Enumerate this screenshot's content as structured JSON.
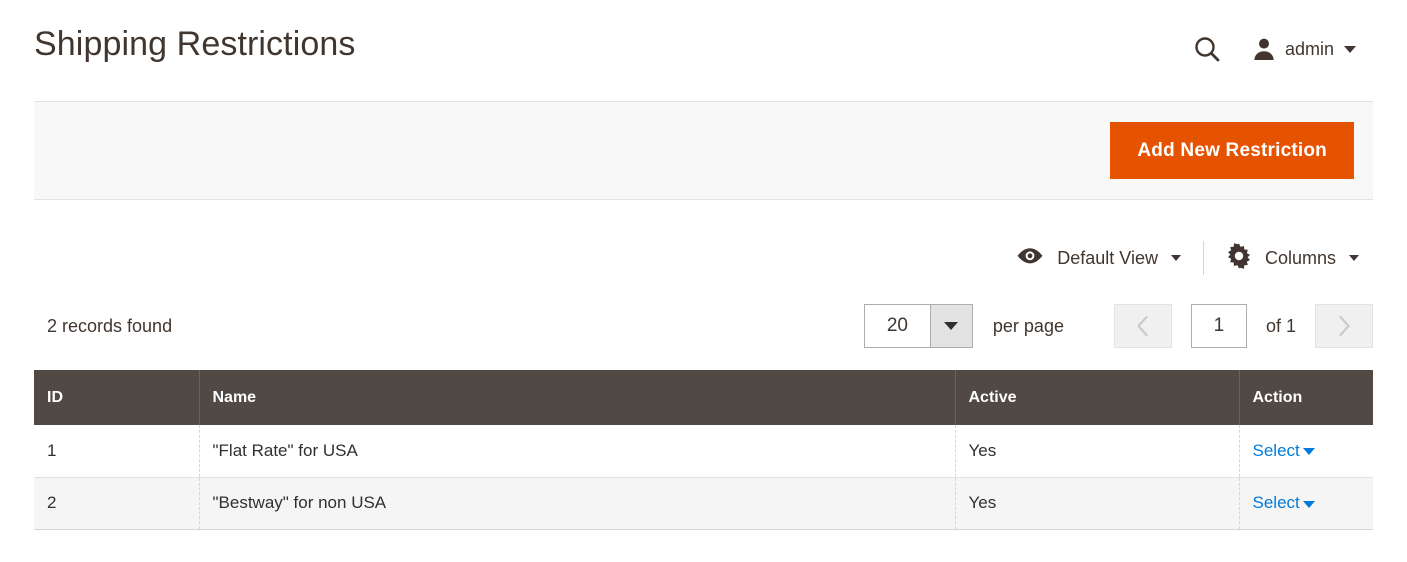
{
  "header": {
    "title": "Shipping Restrictions",
    "search_icon": "search-icon",
    "user_icon": "user-icon",
    "admin_label": "admin"
  },
  "page_actions": {
    "add_button_label": "Add New Restriction",
    "add_button_color": "#e55200"
  },
  "grid_controls": {
    "view_icon": "eye-icon",
    "view_label": "Default View",
    "columns_icon": "gear-icon",
    "columns_label": "Columns"
  },
  "grid_toolbar": {
    "records_found": "2 records found",
    "per_page_value": "20",
    "per_page_label": "per page",
    "prev_icon": "chevron-left-icon",
    "next_icon": "chevron-right-icon",
    "current_page": "1",
    "of_total": "of 1"
  },
  "grid": {
    "columns": [
      {
        "key": "id",
        "label": "ID"
      },
      {
        "key": "name",
        "label": "Name"
      },
      {
        "key": "active",
        "label": "Active"
      },
      {
        "key": "action",
        "label": "Action"
      }
    ],
    "rows": [
      {
        "id": "1",
        "name": "\"Flat Rate\" for USA",
        "active": "Yes",
        "action_label": "Select"
      },
      {
        "id": "2",
        "name": "\"Bestway\" for non USA",
        "active": "Yes",
        "action_label": "Select"
      }
    ],
    "header_bg": "#514943",
    "link_color": "#007bdb"
  }
}
